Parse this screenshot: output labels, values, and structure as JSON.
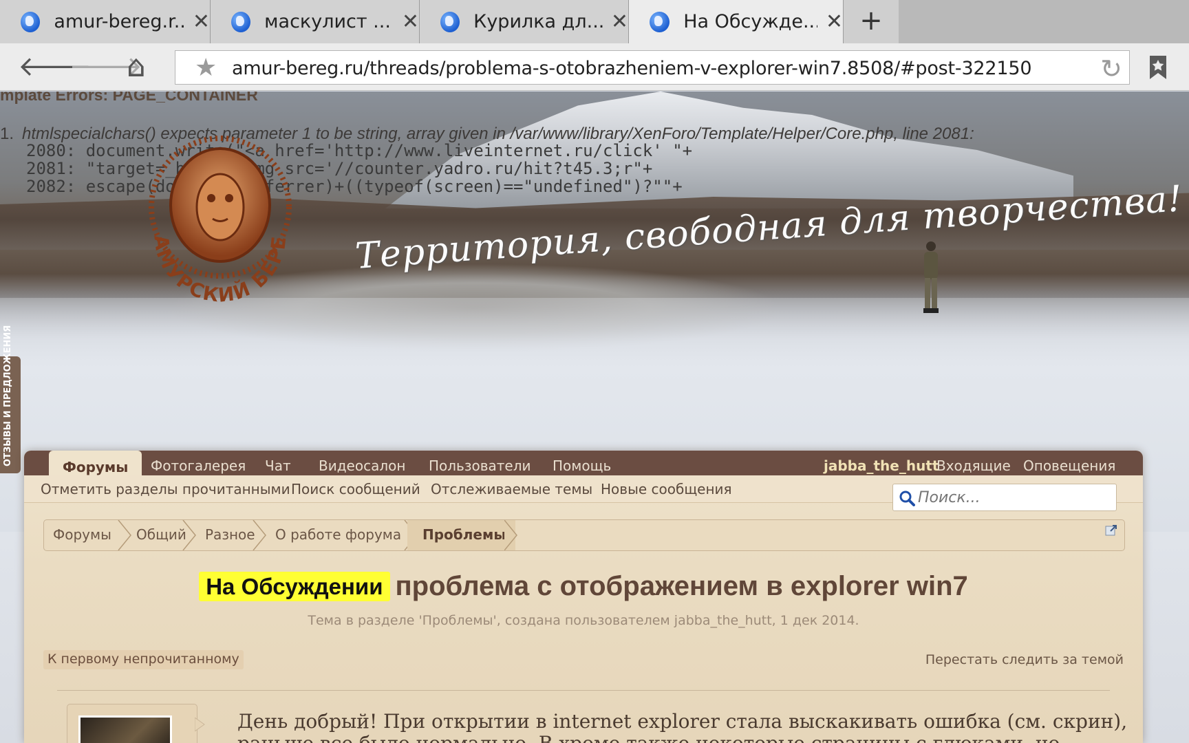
{
  "browser": {
    "tabs": [
      {
        "title": "amur-bereg.r...",
        "close": "✕"
      },
      {
        "title": "маскулист ...",
        "close": "✕"
      },
      {
        "title": "Курилка дл...",
        "close": "✕"
      },
      {
        "title": "На Обсужде...",
        "close": "✕"
      }
    ],
    "new_tab": "+",
    "url": "amur-bereg.ru/threads/problema-s-otobrazheniem-v-explorer-win7.8508/#post-322150",
    "back": "🡐",
    "forward": "🡒",
    "home": "⌂",
    "star": "★",
    "reload": "↻"
  },
  "error": {
    "title": "mplate Errors: PAGE_CONTAINER",
    "index": "1.",
    "message": "htmlspecialchars() expects parameter 1 to be string, array given in /var/www/library/XenForo/Template/Helper/Core.php, line 2081:",
    "code": [
      "2080: document.write(\"<a href='http://www.liveinternet.ru/click' \"+",
      "2081: \"target=_blank><img src='//counter.yadro.ru/hit?t45.3;r\"+",
      "2082: escape(document.referrer)+((typeof(screen)==\"undefined\")?\"\"+"
    ]
  },
  "header": {
    "slogan": "Территория, свободная для творчества!",
    "feedback_tab": "ОТЗЫВЫ И ПРЕДЛОЖЕНИЯ"
  },
  "nav": {
    "items": [
      "Форумы",
      "Фотогалерея",
      "Чат",
      "Видеосалон",
      "Пользователи",
      "Помощь"
    ],
    "user": "jabba_the_hutt",
    "inbox": "Входящие",
    "alerts": "Оповещения"
  },
  "subnav": {
    "items": [
      "Отметить разделы прочитанными",
      "Поиск сообщений",
      "Отслеживаемые темы",
      "Новые сообщения"
    ]
  },
  "search": {
    "placeholder": "Поиск..."
  },
  "breadcrumb": [
    "Форумы",
    "Общий",
    "Разное",
    "О работе форума",
    "Проблемы"
  ],
  "thread": {
    "prefix": "На Обсуждении",
    "title": "проблема с отображением в explorer win7",
    "meta": "Тема в разделе 'Проблемы', создана пользователем jabba_the_hutt, 1 дек 2014."
  },
  "actions": {
    "first_unread": "К первому непрочитанному",
    "unwatch": "Перестать следить за темой"
  },
  "post": {
    "line1": "День добрый! При открытии в internet explorer стала выскакивать ошибка (см. скрин),",
    "line2": "раньше все было нормально. В хроме также некоторые страницы с глюками, но"
  }
}
